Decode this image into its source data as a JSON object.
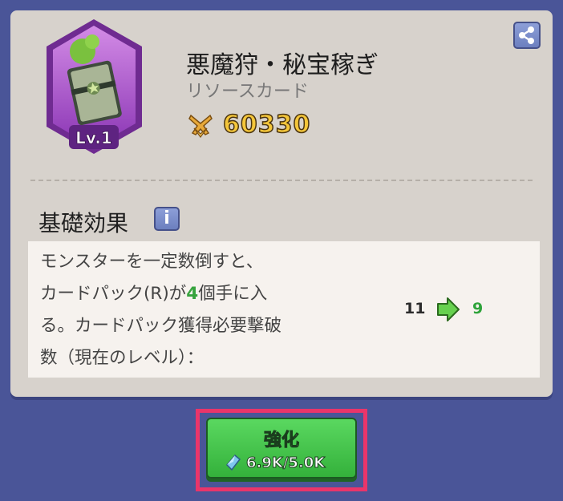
{
  "card": {
    "title": "悪魔狩・秘宝稼ぎ",
    "subtitle": "リソースカード",
    "level": "Lv.1",
    "power": "60330",
    "power_icon": "crossed-swords-icon"
  },
  "effect": {
    "section_title": "基礎効果",
    "info_icon": "i",
    "lines": [
      "モンスターを一定数倒すと、",
      "カードパック(R)が",
      "個手に入",
      "る。カードパック獲得必要撃破",
      "数（現在のレベル）："
    ],
    "highlight_value": "4",
    "from_value": "11",
    "to_value": "9"
  },
  "upgrade_button": {
    "label": "強化",
    "cost": "6.9K/5.0K",
    "cost_icon": "gem-icon"
  },
  "colors": {
    "background": "#4a5598",
    "panel": "#d7d2cc",
    "button": "#4ccb51",
    "highlight_border": "#e9356a",
    "power_text": "#f4c63a",
    "effect_value": "#36a33d"
  }
}
